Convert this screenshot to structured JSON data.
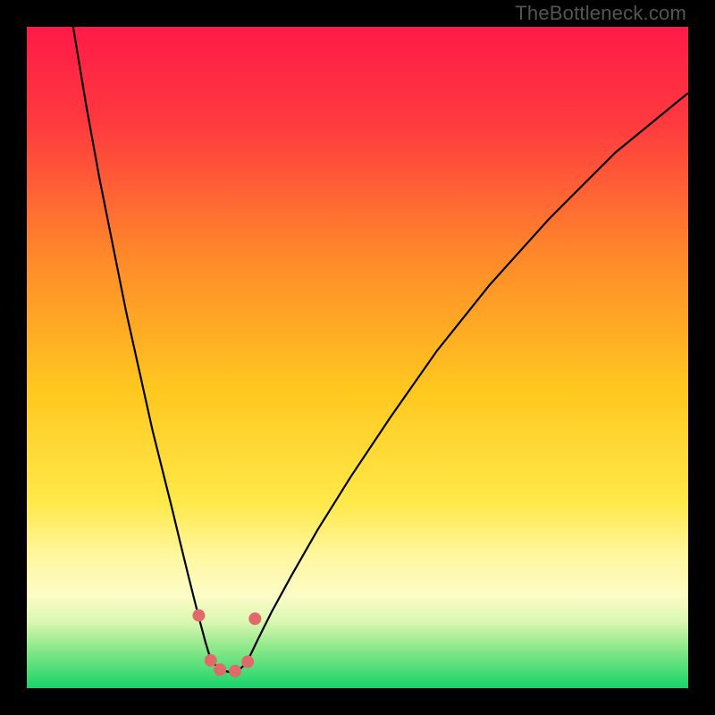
{
  "watermark": "TheBottleneck.com",
  "chart_data": {
    "type": "line",
    "title": "",
    "xlabel": "",
    "ylabel": "",
    "xlim": [
      0,
      100
    ],
    "ylim": [
      0,
      100
    ],
    "background_gradient": {
      "stops": [
        {
          "offset": 0.0,
          "color": "#ff1a47"
        },
        {
          "offset": 0.15,
          "color": "#ff3b3f"
        },
        {
          "offset": 0.35,
          "color": "#ff8a2a"
        },
        {
          "offset": 0.55,
          "color": "#ffc81f"
        },
        {
          "offset": 0.72,
          "color": "#ffe94a"
        },
        {
          "offset": 0.8,
          "color": "#fff7a0"
        },
        {
          "offset": 0.86,
          "color": "#fdfcc7"
        },
        {
          "offset": 0.9,
          "color": "#d9f7b0"
        },
        {
          "offset": 0.94,
          "color": "#8be889"
        },
        {
          "offset": 1.0,
          "color": "#17d36b"
        }
      ]
    },
    "series": [
      {
        "name": "left-branch",
        "x": [
          7,
          9,
          11,
          13,
          15,
          17,
          19,
          20.5,
          22,
          23.2,
          24.3,
          25.3,
          26.2,
          27,
          27.6
        ],
        "y": [
          100,
          88,
          77,
          67,
          57,
          48,
          39,
          33,
          27,
          22,
          17.5,
          13.5,
          10,
          7,
          5
        ]
      },
      {
        "name": "valley-floor",
        "x": [
          27.6,
          28.4,
          29.5,
          30.8,
          32.0,
          33.0,
          33.8
        ],
        "y": [
          5,
          3.6,
          2.7,
          2.4,
          2.7,
          3.6,
          5
        ]
      },
      {
        "name": "right-branch",
        "x": [
          33.8,
          35,
          37,
          40,
          44,
          49,
          55,
          62,
          70,
          79,
          89,
          100
        ],
        "y": [
          5,
          7.5,
          11.5,
          17,
          24,
          32,
          41,
          51,
          61,
          71,
          81,
          90
        ]
      }
    ],
    "markers": {
      "name": "valley-points",
      "color": "#e06a6a",
      "radius": 7,
      "points": [
        {
          "x": 26.0,
          "y": 11
        },
        {
          "x": 27.8,
          "y": 4.2
        },
        {
          "x": 29.2,
          "y": 2.8
        },
        {
          "x": 31.5,
          "y": 2.6
        },
        {
          "x": 33.4,
          "y": 4.0
        },
        {
          "x": 34.5,
          "y": 10.5
        }
      ]
    }
  }
}
